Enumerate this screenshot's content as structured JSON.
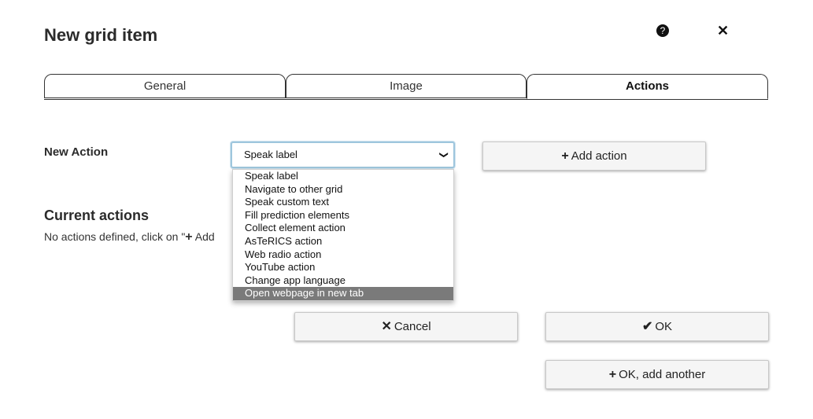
{
  "dialog": {
    "title": "New grid item",
    "help_icon": "question-circle-icon",
    "close_icon": "close-icon"
  },
  "tabs": [
    {
      "label": "General",
      "active": false
    },
    {
      "label": "Image",
      "active": false
    },
    {
      "label": "Actions",
      "active": true
    }
  ],
  "new_action": {
    "label": "New Action",
    "selected": "Speak label",
    "options": [
      "Speak label",
      "Navigate to other grid",
      "Speak custom text",
      "Fill prediction elements",
      "Collect element action",
      "AsTeRICS action",
      "Web radio action",
      "YouTube action",
      "Change app language",
      "Open webpage in new tab"
    ],
    "highlighted_option": "Open webpage in new tab",
    "add_button": "Add action"
  },
  "current_actions": {
    "heading": "Current actions",
    "empty_text_prefix": "No actions defined, click on \"",
    "empty_text_link": "Add"
  },
  "footer": {
    "cancel": "Cancel",
    "ok": "OK",
    "ok_add_another": "OK, add another"
  },
  "colors": {
    "highlight": "#7a7a7a",
    "focus_border": "#9ec6dd"
  }
}
